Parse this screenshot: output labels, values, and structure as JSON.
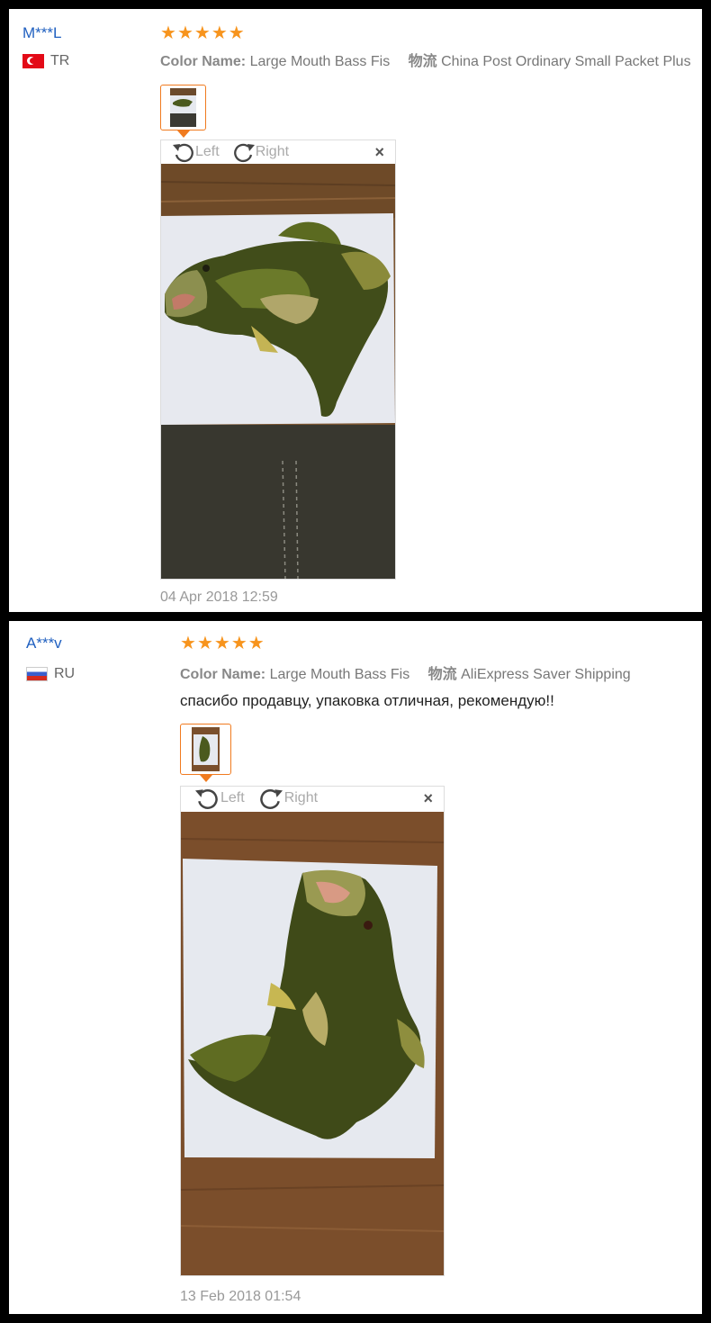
{
  "reviews": [
    {
      "user": "M***L",
      "country": "TR",
      "stars": [
        "★",
        "★",
        "★",
        "★",
        "★"
      ],
      "color_label": "Color Name:",
      "color_value": "Large Mouth Bass Fis",
      "shipping_label": "物流",
      "shipping_value": "China Post Ordinary Small Packet Plus",
      "feedback": "",
      "rotate_left": "Left",
      "rotate_right": "Right",
      "close": "×",
      "date": "04 Apr 2018 12:59"
    },
    {
      "user": "A***v",
      "country": "RU",
      "stars": [
        "★",
        "★",
        "★",
        "★",
        "★"
      ],
      "color_label": "Color Name:",
      "color_value": "Large Mouth Bass Fis",
      "shipping_label": "物流",
      "shipping_value": "AliExpress Saver Shipping",
      "feedback": "спасибо продавцу, упаковка отличная, рекомендую!!",
      "rotate_left": "Left",
      "rotate_right": "Right",
      "close": "×",
      "date": "13 Feb 2018 01:54"
    }
  ],
  "colors": {
    "accent": "#f07b1f",
    "star": "#f7941d",
    "user_link": "#2060c0"
  }
}
